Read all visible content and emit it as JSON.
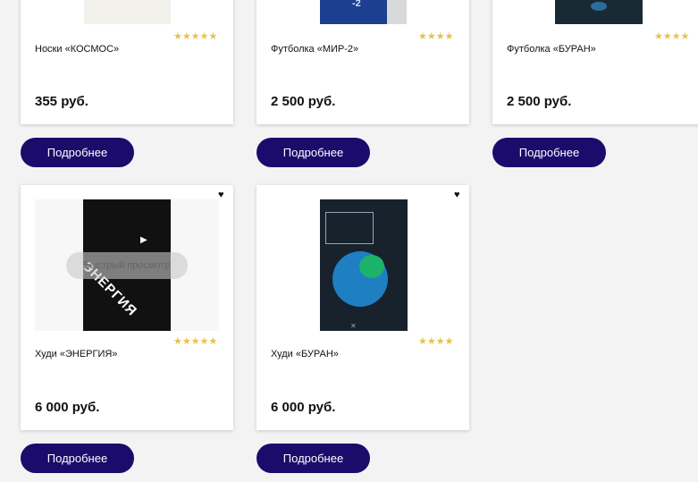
{
  "products": [
    {
      "title": "Носки «КОСМОС»",
      "price": "355 руб.",
      "rating": 5,
      "stars": "★★★★★",
      "button": "Подробнее"
    },
    {
      "title": "Футболка «МИР-2»",
      "price": "2 500 руб.",
      "rating": 4,
      "stars": "★★★★",
      "button": "Подробнее"
    },
    {
      "title": "Футболка «БУРАН»",
      "price": "2 500 руб.",
      "rating": 4,
      "stars": "★★★★",
      "button": "Подробнее"
    },
    {
      "title": "Худи «ЭНЕРГИЯ»",
      "price": "6 000 руб.",
      "rating": 5,
      "stars": "★★★★★",
      "button": "Подробнее",
      "quick_view": "Быстрый просмотр",
      "print_text": "ЭНЕРГИЯ"
    },
    {
      "title": "Худи «БУРАН»",
      "price": "6 000 руб.",
      "rating": 4,
      "stars": "★★★★",
      "button": "Подробнее"
    }
  ],
  "icons": {
    "heart": "♥",
    "play": "▶"
  },
  "colors": {
    "button_bg": "#1b0b6b",
    "stars": "#e8c14a",
    "background": "#f3f3f4"
  }
}
